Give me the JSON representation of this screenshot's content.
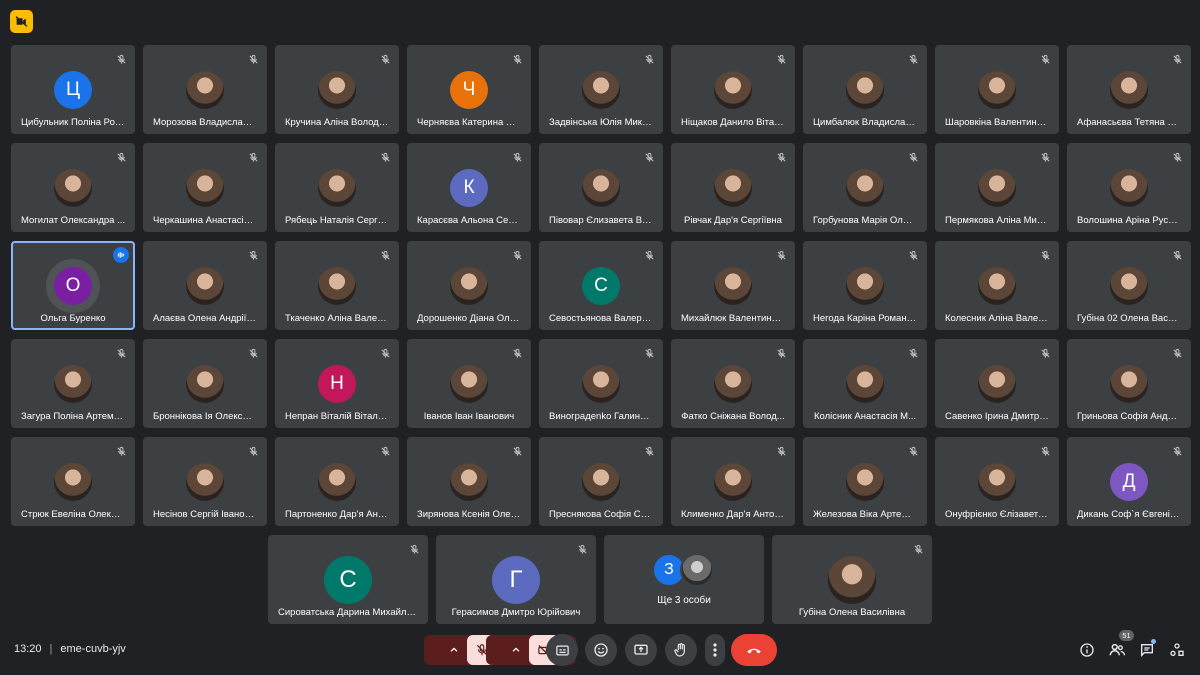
{
  "meeting": {
    "time": "13:20",
    "separator": "|",
    "code": "eme-cuvb-yjv",
    "participant_count": "51"
  },
  "colors": {
    "background": "#202124",
    "tile": "#3c4043",
    "active_outline": "#8ab4f8",
    "end_call": "#ea4335",
    "badge": "#fbbc04"
  },
  "participants": [
    {
      "name": "Цибульник Поліна Ром...",
      "initial": "Ц",
      "color": "#1a73e8"
    },
    {
      "name": "Морозова Владислава...",
      "photo": true
    },
    {
      "name": "Кручина Аліна Володи...",
      "photo": true
    },
    {
      "name": "Черняєва Катерина Ру...",
      "initial": "Ч",
      "color": "#e8710a"
    },
    {
      "name": "Задвінська Юлія Мико...",
      "photo": true
    },
    {
      "name": "Ніщаков Данило Віталі...",
      "photo": true
    },
    {
      "name": "Цимбалюк Владислав...",
      "photo": true
    },
    {
      "name": "Шаровкіна Валентина ...",
      "photo": true
    },
    {
      "name": "Афанасьєва Тетяна Оле...",
      "photo": true
    },
    {
      "name": "Могилат Олександра ...",
      "photo": true
    },
    {
      "name": "Черкашина Анастасія ...",
      "photo": true
    },
    {
      "name": "Рябець Наталія Сергіїв...",
      "photo": true
    },
    {
      "name": "Карасєва Альона Серг...",
      "initial": "К",
      "color": "#5c6bc0"
    },
    {
      "name": "Півовар Єлизавета Вя...",
      "photo": true
    },
    {
      "name": "Рівчак Дар'я Сергіївна",
      "photo": true
    },
    {
      "name": "Горбунова Марія Олек...",
      "photo": true
    },
    {
      "name": "Пермякова Аліна Мих...",
      "photo": true
    },
    {
      "name": "Волошина Аріна Русла...",
      "photo": true
    },
    {
      "name": "Ольга Буренко",
      "initial": "О",
      "color": "#7b1fa2",
      "active": true
    },
    {
      "name": "Алаєва Олена Андріїв...",
      "photo": true
    },
    {
      "name": "Ткаченко Аліна Валері...",
      "photo": true
    },
    {
      "name": "Дорошенко Діана Оле...",
      "photo": true
    },
    {
      "name": "Севостьянова Валерія...",
      "initial": "С",
      "color": "#00796b"
    },
    {
      "name": "Михайлюк Валентина ...",
      "photo": true
    },
    {
      "name": "Негода Каріна Романів...",
      "photo": true
    },
    {
      "name": "Колесник Аліна Валер...",
      "photo": true
    },
    {
      "name": "Губіна 02 Олена Васил...",
      "photo": true
    },
    {
      "name": "Загура Поліна Артемів...",
      "photo": true
    },
    {
      "name": "Броннікова Ія Олексан...",
      "photo": true
    },
    {
      "name": "Непран Віталій Віталій...",
      "initial": "Н",
      "color": "#c2185b"
    },
    {
      "name": "Іванов Іван Іванович",
      "photo": true
    },
    {
      "name": "Виноградenko Галина ...",
      "photo": true
    },
    {
      "name": "Фатко Сніжана Волод...",
      "photo": true
    },
    {
      "name": "Колісник Анастасія М...",
      "photo": true
    },
    {
      "name": "Савенко Ірина Дмитрі...",
      "photo": true
    },
    {
      "name": "Гриньова Софія Андрії...",
      "photo": true
    },
    {
      "name": "Стрюк Евеліна Олекса...",
      "photo": true
    },
    {
      "name": "Несінов Сергій Іванов...",
      "photo": true
    },
    {
      "name": "Партоненко Дар'я Анд...",
      "photo": true
    },
    {
      "name": "Зирянова Ксенія Олек...",
      "photo": true
    },
    {
      "name": "Преснякова Софія Се...",
      "photo": true
    },
    {
      "name": "Клименко Дар'я Антон...",
      "photo": true
    },
    {
      "name": "Железова Віка Артемі...",
      "photo": true
    },
    {
      "name": "Онуфрієнко Єлізавета...",
      "photo": true
    },
    {
      "name": "Дикань Соф`я Євгенів...",
      "initial": "Д",
      "color": "#7e57c2"
    }
  ],
  "last_row": [
    {
      "name": "Сироватська Дарина Михайлів...",
      "initial": "С",
      "color": "#00796b"
    },
    {
      "name": "Герасимов Дмитро Юрійович",
      "initial": "Г",
      "color": "#5c6bc0"
    },
    {
      "more": true,
      "label": "Ще 3 особи",
      "initial": "З"
    },
    {
      "name": "Губіна Олена Василівна",
      "photo": true
    }
  ],
  "icons": {
    "top_badge": "camera-off-icon",
    "tile_status": "mic-off-icon",
    "speaking": "audio-wave-icon",
    "controls": [
      "chevron-up-icon",
      "mic-off-icon",
      "chevron-up-icon",
      "camera-off-icon",
      "captions-icon",
      "emoji-icon",
      "present-icon",
      "raise-hand-icon",
      "more-vert-icon",
      "end-call-icon"
    ],
    "right": [
      "info-icon",
      "people-icon",
      "chat-icon",
      "activities-icon"
    ]
  }
}
